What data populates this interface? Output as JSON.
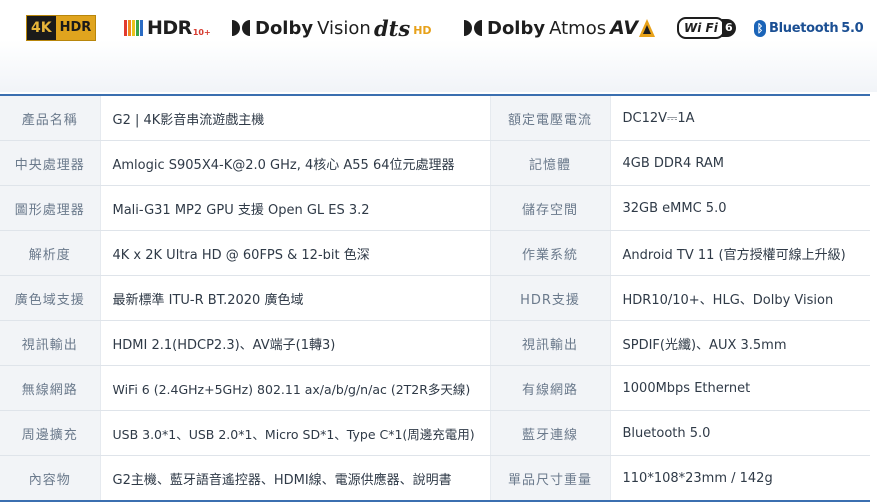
{
  "logos": {
    "uhd": {
      "mark": "4K",
      "text": "HDR"
    },
    "hdr10plus": {
      "text": "HDR",
      "suffix": "10+"
    },
    "dolby_vision": {
      "brand": "Dolby",
      "product": "Vision"
    },
    "dts": {
      "brand": "dts",
      "suffix": "HD"
    },
    "dolby_atmos": {
      "brand": "Dolby",
      "product": "Atmos"
    },
    "av1": {
      "text": "AV"
    },
    "wifi6": {
      "text": "Wi Fi",
      "number": "6"
    },
    "bluetooth": {
      "text": "Bluetooth",
      "version": "5.0"
    }
  },
  "colors": {
    "accent_blue": "#3b6fb0",
    "label_bg": "#f2f4f7",
    "label_text": "#6b7a8c",
    "value_text": "#2f3a47"
  },
  "specs": [
    {
      "label1": "產品名稱",
      "value1": "G2 | 4K影音串流遊戲主機",
      "label2": "額定電壓電流",
      "value2": "DC12V⎓1A"
    },
    {
      "label1": "中央處理器",
      "value1": "Amlogic S905X4-K@2.0 GHz, 4核心 A55 64位元處理器",
      "label2": "記憶體",
      "value2": "4GB DDR4 RAM"
    },
    {
      "label1": "圖形處理器",
      "value1": "Mali-G31 MP2 GPU 支援 Open GL ES 3.2",
      "label2": "儲存空間",
      "value2": "32GB eMMC 5.0"
    },
    {
      "label1": "解析度",
      "value1": "4K x 2K Ultra HD @ 60FPS & 12-bit 色深",
      "label2": "作業系統",
      "value2": "Android TV 11 (官方授權可線上升級)"
    },
    {
      "label1": "廣色域支援",
      "value1": "最新標準 ITU-R BT.2020 廣色域",
      "label2": "HDR支援",
      "value2": "HDR10/10+、HLG、Dolby Vision"
    },
    {
      "label1": "視訊輸出",
      "value1": "HDMI 2.1(HDCP2.3)、AV端子(1轉3)",
      "label2": "視訊輸出",
      "value2": "SPDIF(光纖)、AUX 3.5mm"
    },
    {
      "label1": "無線網路",
      "value1": "WiFi 6 (2.4GHz+5GHz) 802.11 ax/a/b/g/n/ac (2T2R多天線)",
      "label2": "有線網路",
      "value2": "1000Mbps Ethernet"
    },
    {
      "label1": "周邊擴充",
      "value1": "USB 3.0*1、USB 2.0*1、Micro SD*1、Type C*1(周邊充電用)",
      "label2": "藍牙連線",
      "value2": "Bluetooth 5.0"
    },
    {
      "label1": "內容物",
      "value1": "G2主機、藍牙語音遙控器、HDMI線、電源供應器、說明書",
      "label2": "單品尺寸重量",
      "value2": "110*108*23mm / 142g"
    }
  ]
}
